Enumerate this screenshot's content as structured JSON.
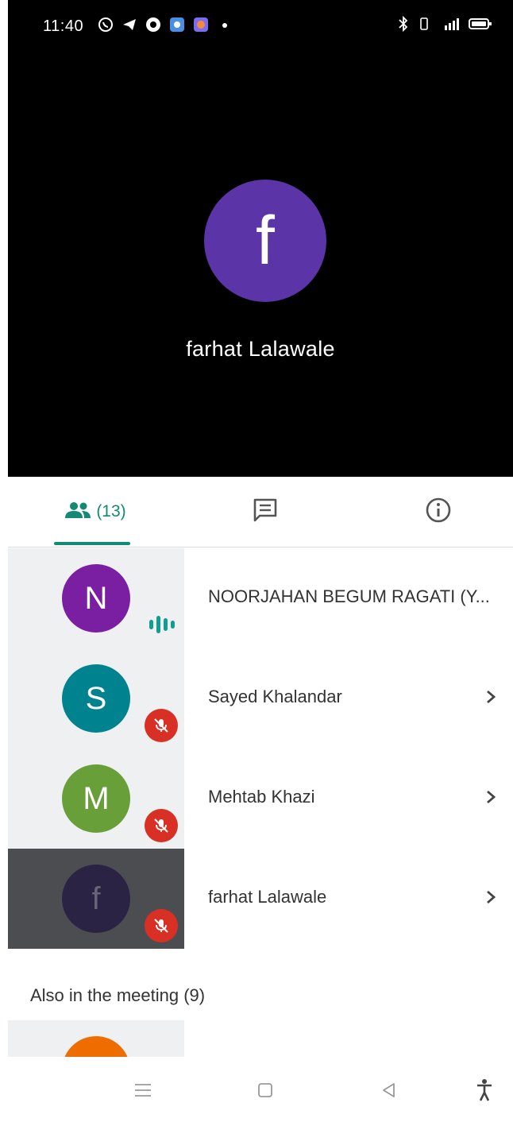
{
  "statusbar": {
    "time": "11:40",
    "left_icons": [
      "whatsapp-icon",
      "telegram-icon",
      "app-icon",
      "camera-app-icon",
      "browser-icon",
      "dot-icon"
    ],
    "right_icons": [
      "bluetooth-icon",
      "vibrate-icon",
      "signal-icon",
      "battery-icon"
    ]
  },
  "speaker": {
    "initial": "f",
    "name": "farhat Lalawale",
    "avatar_color": "#5b34a8"
  },
  "tabs": {
    "people_count": "(13)",
    "people_icon": "people-icon",
    "chat_icon": "chat-icon",
    "info_icon": "info-icon",
    "accent": "#138a74"
  },
  "participants": [
    {
      "initial": "N",
      "name": "NOORJAHAN BEGUM RAGATI (Y...",
      "color": "#7b1fa2",
      "state": "talking"
    },
    {
      "initial": "S",
      "name": "Sayed Khalandar",
      "color": "#00838f",
      "state": "muted"
    },
    {
      "initial": "M",
      "name": "Mehtab Khazi",
      "color": "#689f38",
      "state": "muted"
    },
    {
      "initial": "f",
      "name": "farhat Lalawale",
      "color": "#2a2344",
      "state": "muted"
    }
  ],
  "also_in_meeting": {
    "title": "Also in the meeting (9)",
    "next_avatar_color": "#ef6c00"
  },
  "navbar": [
    "menu-icon",
    "home-icon",
    "back-icon",
    "accessibility-icon"
  ]
}
